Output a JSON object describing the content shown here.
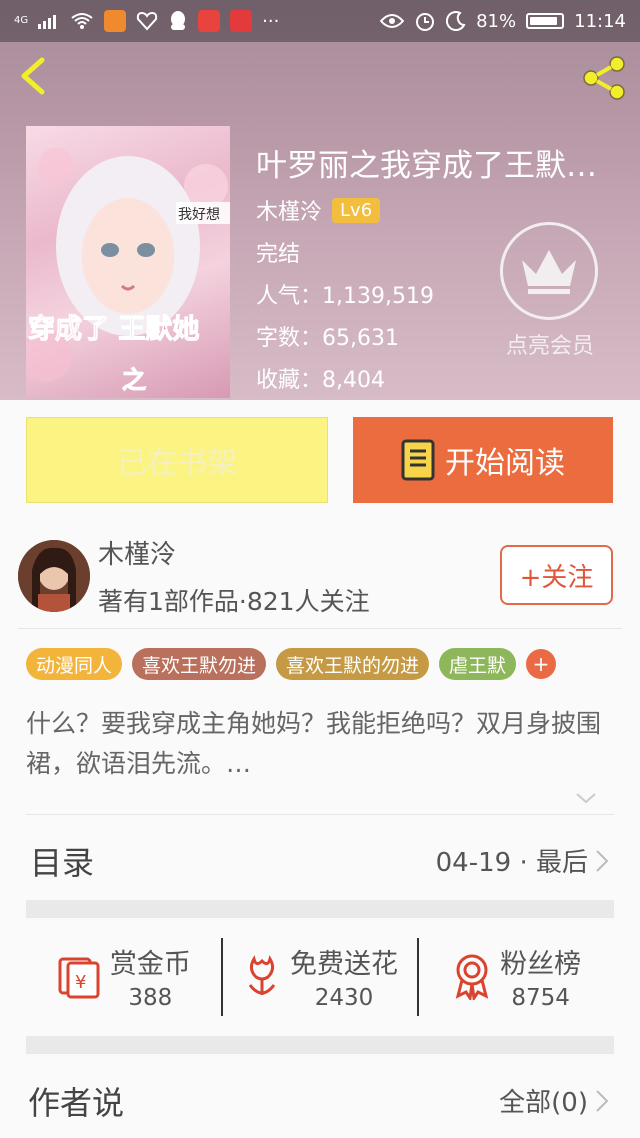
{
  "status_bar": {
    "network": "4G",
    "battery": "81%",
    "time": "11:14",
    "more": "···"
  },
  "book": {
    "title": "叶罗丽之我穿成了王默…",
    "author": "木槿泠",
    "level": "Lv6",
    "status": "完结",
    "popularity": "人气：1,139,519",
    "words": "字数：65,631",
    "favorites": "收藏：8,404",
    "cover_text_1": "我好想",
    "cover_text_2": "穿成了 王默她",
    "cover_text_3": "之"
  },
  "vip": {
    "label": "点亮会员",
    "icon": "crown-icon"
  },
  "actions": {
    "shelf_label": "已在书架",
    "read_label": "开始阅读"
  },
  "author": {
    "name": "木槿泠",
    "stats": "著有1部作品·821人关注",
    "follow_label": "+关注"
  },
  "tags": [
    {
      "label": "动漫同人",
      "color": "#f3b43c"
    },
    {
      "label": "喜欢王默勿进",
      "color": "#b9705c"
    },
    {
      "label": "喜欢王默的勿进",
      "color": "#c69a45"
    },
    {
      "label": "虐王默",
      "color": "#8eb65a"
    }
  ],
  "tag_plus": "+",
  "synopsis": "什么？要我穿成主角她妈？我能拒绝吗？双月身披围裙，欲语泪先流。…",
  "toc": {
    "title": "目录",
    "latest": "04-19 · 最后"
  },
  "stats": [
    {
      "label": "赏金币",
      "value": "388",
      "icon": "red-envelope-icon"
    },
    {
      "label": "免费送花",
      "value": "2430",
      "icon": "flower-icon"
    },
    {
      "label": "粉丝榜",
      "value": "8754",
      "icon": "ribbon-badge-icon"
    }
  ],
  "author_says": {
    "title": "作者说",
    "count": "全部(0)"
  },
  "colors": {
    "accent": "#eb6c3e",
    "shelf_bg": "#fbf482",
    "badge": "#f3bd3e"
  }
}
